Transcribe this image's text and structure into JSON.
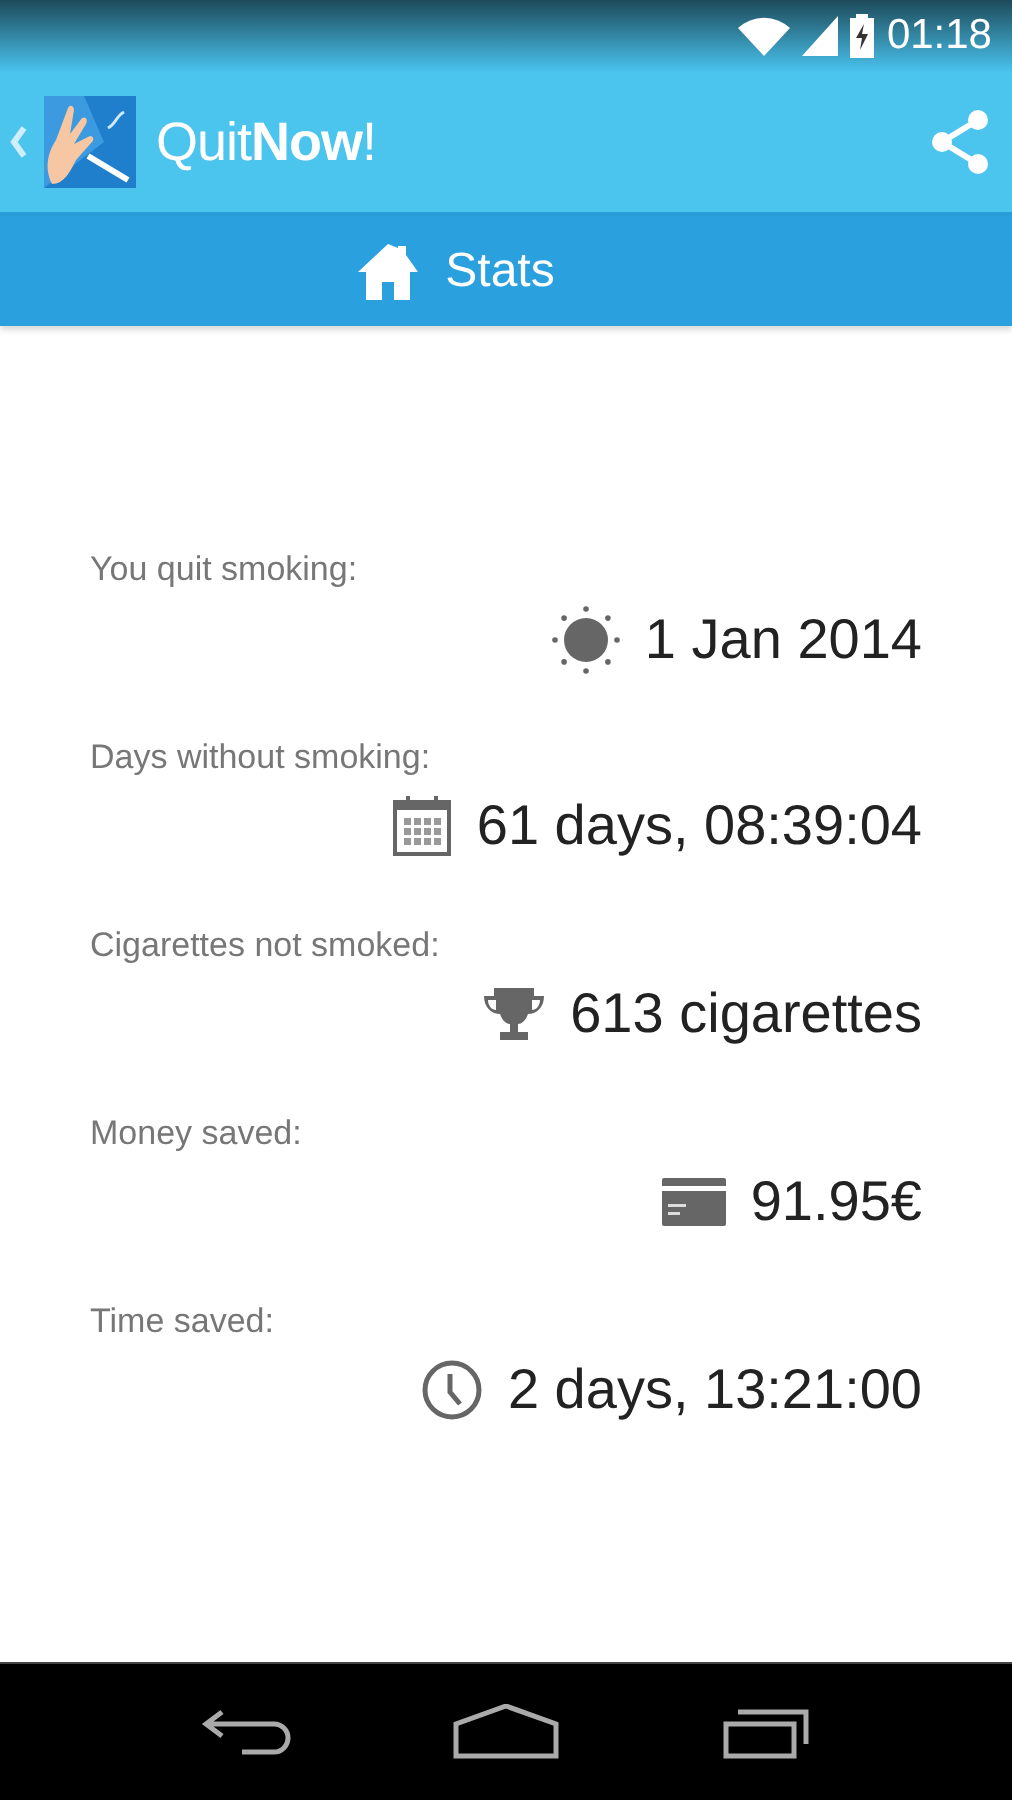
{
  "status_bar": {
    "time": "01:18"
  },
  "app_bar": {
    "title": "Quit**Now**!"
  },
  "tab": {
    "label": "Stats"
  },
  "stats": [
    {
      "kind": "date",
      "label": "You quit smoking:",
      "value": "1 Jan 2014"
    },
    {
      "kind": "calendar",
      "label": "Days without smoking:",
      "value": "61 days, 08:39:04"
    },
    {
      "kind": "trophy",
      "label": "Cigarettes not smoked:",
      "value": "613 cigarettes"
    },
    {
      "kind": "money",
      "label": "Money saved:",
      "value": "91.95€"
    },
    {
      "kind": "clock",
      "label": "Time saved:",
      "value": "2 days, 13:21:00"
    }
  ]
}
